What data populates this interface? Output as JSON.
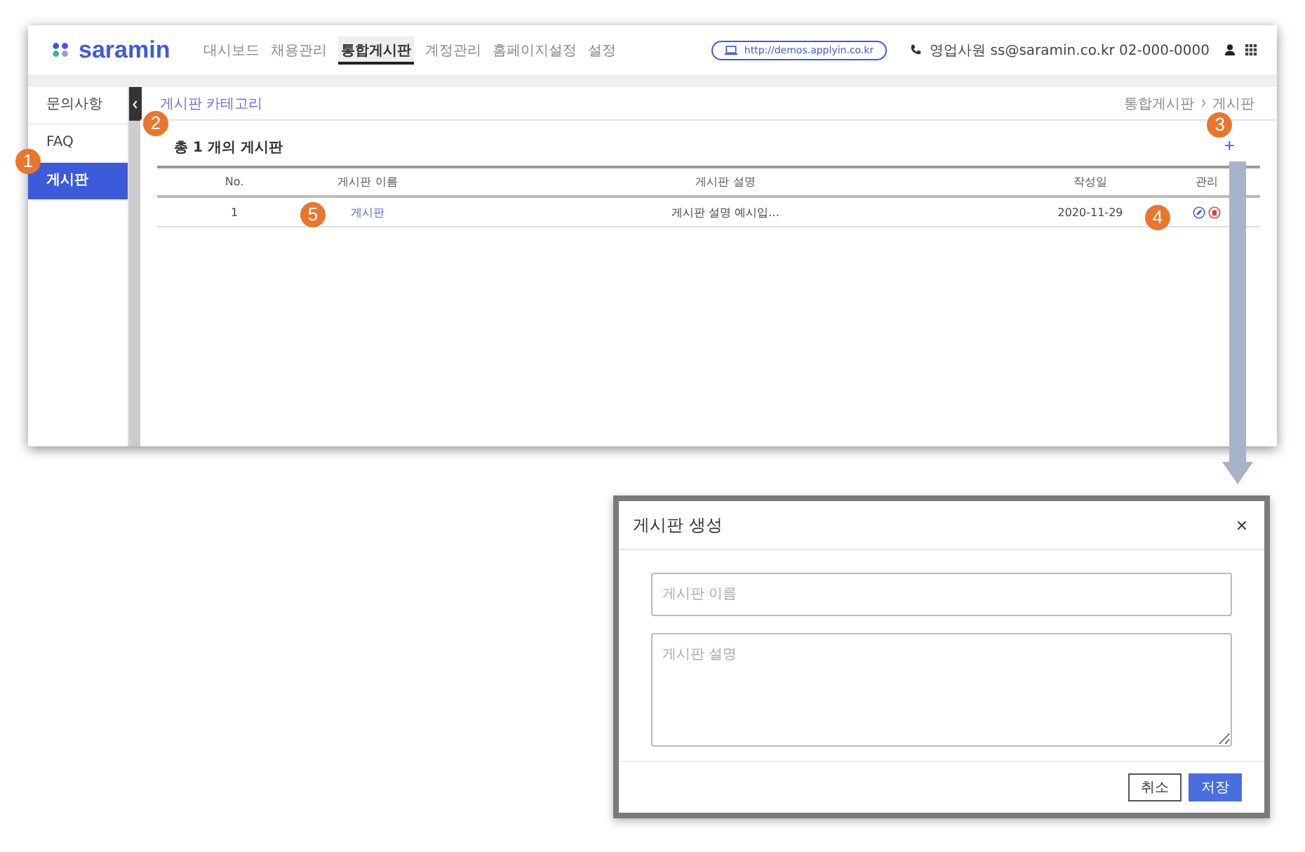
{
  "app": {
    "logo": "saramin",
    "nav": [
      {
        "label": "대시보드",
        "selected": false
      },
      {
        "label": "채용관리",
        "selected": false
      },
      {
        "label": "통합게시판",
        "selected": true
      },
      {
        "label": "계정관리",
        "selected": false
      },
      {
        "label": "홈페이지설정",
        "selected": false
      },
      {
        "label": "설정",
        "selected": false
      }
    ],
    "site_url": "http://demos.applyin.co.kr",
    "contact": "영업사원 ss@saramin.co.kr 02-000-0000"
  },
  "sidebar": {
    "items": [
      {
        "label": "문의사항",
        "selected": false
      },
      {
        "label": "FAQ",
        "selected": false
      },
      {
        "label": "게시판",
        "selected": true,
        "callout": "1"
      }
    ]
  },
  "page": {
    "title": "게시판 카테고리",
    "breadcrumb": [
      "통합게시판",
      "게시판"
    ],
    "count": "총 1 개의 게시판",
    "count_callout": "2",
    "add_button": "+",
    "add_callout": "3"
  },
  "table": {
    "columns": [
      "No.",
      "게시판 이름",
      "게시판 설명",
      "작성일",
      "관리"
    ],
    "rows": [
      {
        "no": "1",
        "name": "게시판",
        "name_callout": "5",
        "description": "게시판 설명 예시입...",
        "date": "2020-11-29",
        "actions_callout": "4"
      }
    ]
  },
  "modal": {
    "title": "게시판 생성",
    "close": "×",
    "fields": [
      {
        "kind": "input",
        "placeholder": "게시판 이름"
      },
      {
        "kind": "textarea",
        "placeholder": "게시판 설명"
      }
    ],
    "buttons": [
      {
        "label": "취소",
        "primary": false
      },
      {
        "label": "저장",
        "primary": true
      }
    ]
  }
}
